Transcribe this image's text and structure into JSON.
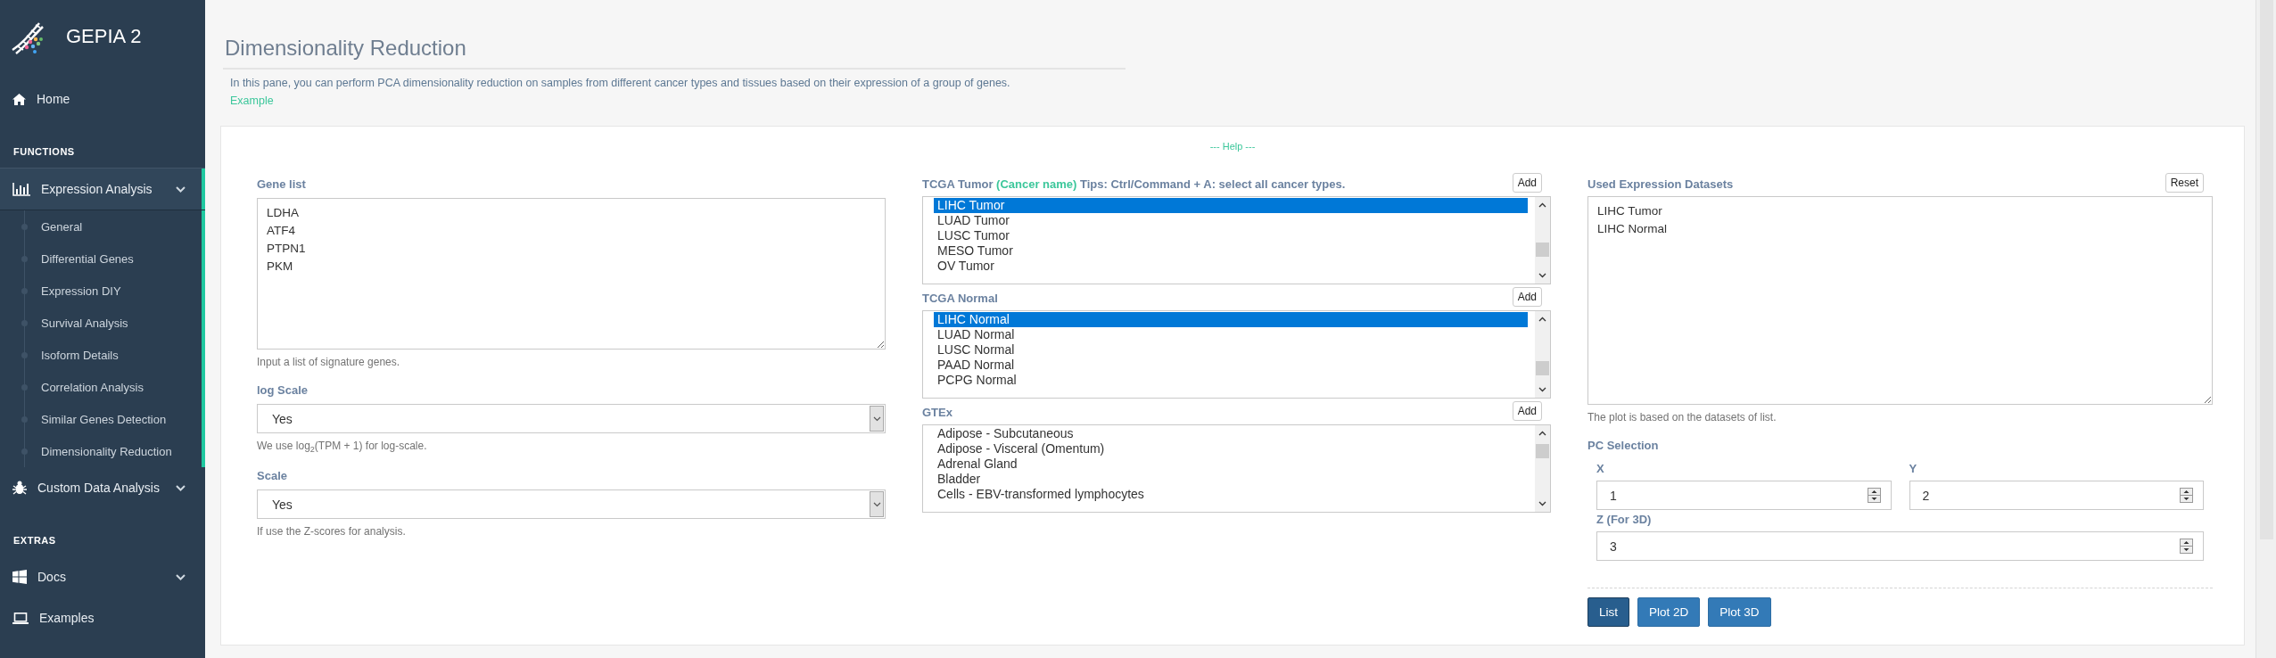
{
  "sidebar": {
    "brand": "GEPIA 2",
    "sections": [
      {
        "items": [
          {
            "label": "Home",
            "selected": false
          }
        ]
      },
      {
        "heading": "FUNCTIONS",
        "items": [
          {
            "label": "Expression Analysis",
            "selected": true,
            "children": [
              {
                "label": "General"
              },
              {
                "label": "Differential Genes"
              },
              {
                "label": "Expression DIY"
              },
              {
                "label": "Survival Analysis"
              },
              {
                "label": "Isoform Details"
              },
              {
                "label": "Correlation Analysis"
              },
              {
                "label": "Similar Genes Detection"
              },
              {
                "label": "Dimensionality Reduction"
              }
            ]
          },
          {
            "label": "Custom Data Analysis",
            "selected": false,
            "chevron": true
          }
        ]
      },
      {
        "heading": "EXTRAS",
        "items": [
          {
            "label": "Docs",
            "selected": false,
            "chevron": true
          },
          {
            "label": "Examples",
            "selected": false
          }
        ]
      }
    ]
  },
  "page": {
    "title": "Dimensionality Reduction",
    "description": "In this pane, you can perform PCA dimensionality reduction on samples from different cancer types and tissues based on their expression of a group of genes.",
    "example_link": "Example"
  },
  "panel": {
    "help_link": "--- Help ---",
    "gene_list": {
      "label": "Gene list",
      "value": [
        "LDHA",
        "ATF4",
        "PTPN1",
        "PKM"
      ],
      "hint": "Input a list of signature genes."
    },
    "log_scale": {
      "label": "log Scale",
      "value": "Yes",
      "hint": "We use log$_{2}$(TPM + 1) for log-scale."
    },
    "scale": {
      "label": "Scale",
      "value": "Yes",
      "hint": "If use the Z-scores for analysis."
    },
    "datasets": [
      {
        "label_parts": [
          {
            "kind": "plain",
            "text": "TCGA Tumor "
          },
          {
            "kind": "accent",
            "text": "(Cancer name)"
          },
          {
            "kind": "plain",
            "text": " Tips: Ctrl/Command + A: select all cancer types."
          }
        ],
        "button": "Add",
        "options": [
          {
            "label": "LIHC Tumor",
            "selected": true
          },
          {
            "label": "LUAD Tumor",
            "selected": false
          },
          {
            "label": "LUSC Tumor",
            "selected": false
          },
          {
            "label": "MESO Tumor",
            "selected": false
          },
          {
            "label": "OV Tumor",
            "selected": false
          }
        ]
      },
      {
        "label_parts": [
          {
            "kind": "plain",
            "text": "TCGA Normal"
          }
        ],
        "button": "Add",
        "options": [
          {
            "label": "LIHC Normal",
            "selected": true
          },
          {
            "label": "LUAD Normal",
            "selected": false
          },
          {
            "label": "LUSC Normal",
            "selected": false
          },
          {
            "label": "PAAD Normal",
            "selected": false
          },
          {
            "label": "PCPG Normal",
            "selected": false
          }
        ]
      },
      {
        "label_parts": [
          {
            "kind": "plain",
            "text": "GTEx"
          }
        ],
        "button": "Add",
        "options": [
          {
            "label": "Adipose - Subcutaneous",
            "selected": false
          },
          {
            "label": "Adipose - Visceral (Omentum)",
            "selected": false
          },
          {
            "label": "Adrenal Gland",
            "selected": false
          },
          {
            "label": "Bladder",
            "selected": false
          },
          {
            "label": "Cells - EBV-transformed lymphocytes",
            "selected": false
          }
        ]
      }
    ],
    "used": {
      "label": "Used Expression Datasets",
      "button": "Reset",
      "value": [
        "LIHC Tumor",
        "LIHC Normal"
      ],
      "hint": "The plot is based on the datasets of list."
    },
    "pc_selection": {
      "label": "PC Selection",
      "fields": [
        {
          "label": "X",
          "value": "1"
        },
        {
          "label": "Y",
          "value": "2"
        },
        {
          "label": "Z (For 3D)",
          "value": "3"
        }
      ]
    },
    "buttons": [
      {
        "label": "List",
        "selected": true
      },
      {
        "label": "Plot 2D",
        "selected": false
      },
      {
        "label": "Plot 3D",
        "selected": false
      }
    ]
  }
}
